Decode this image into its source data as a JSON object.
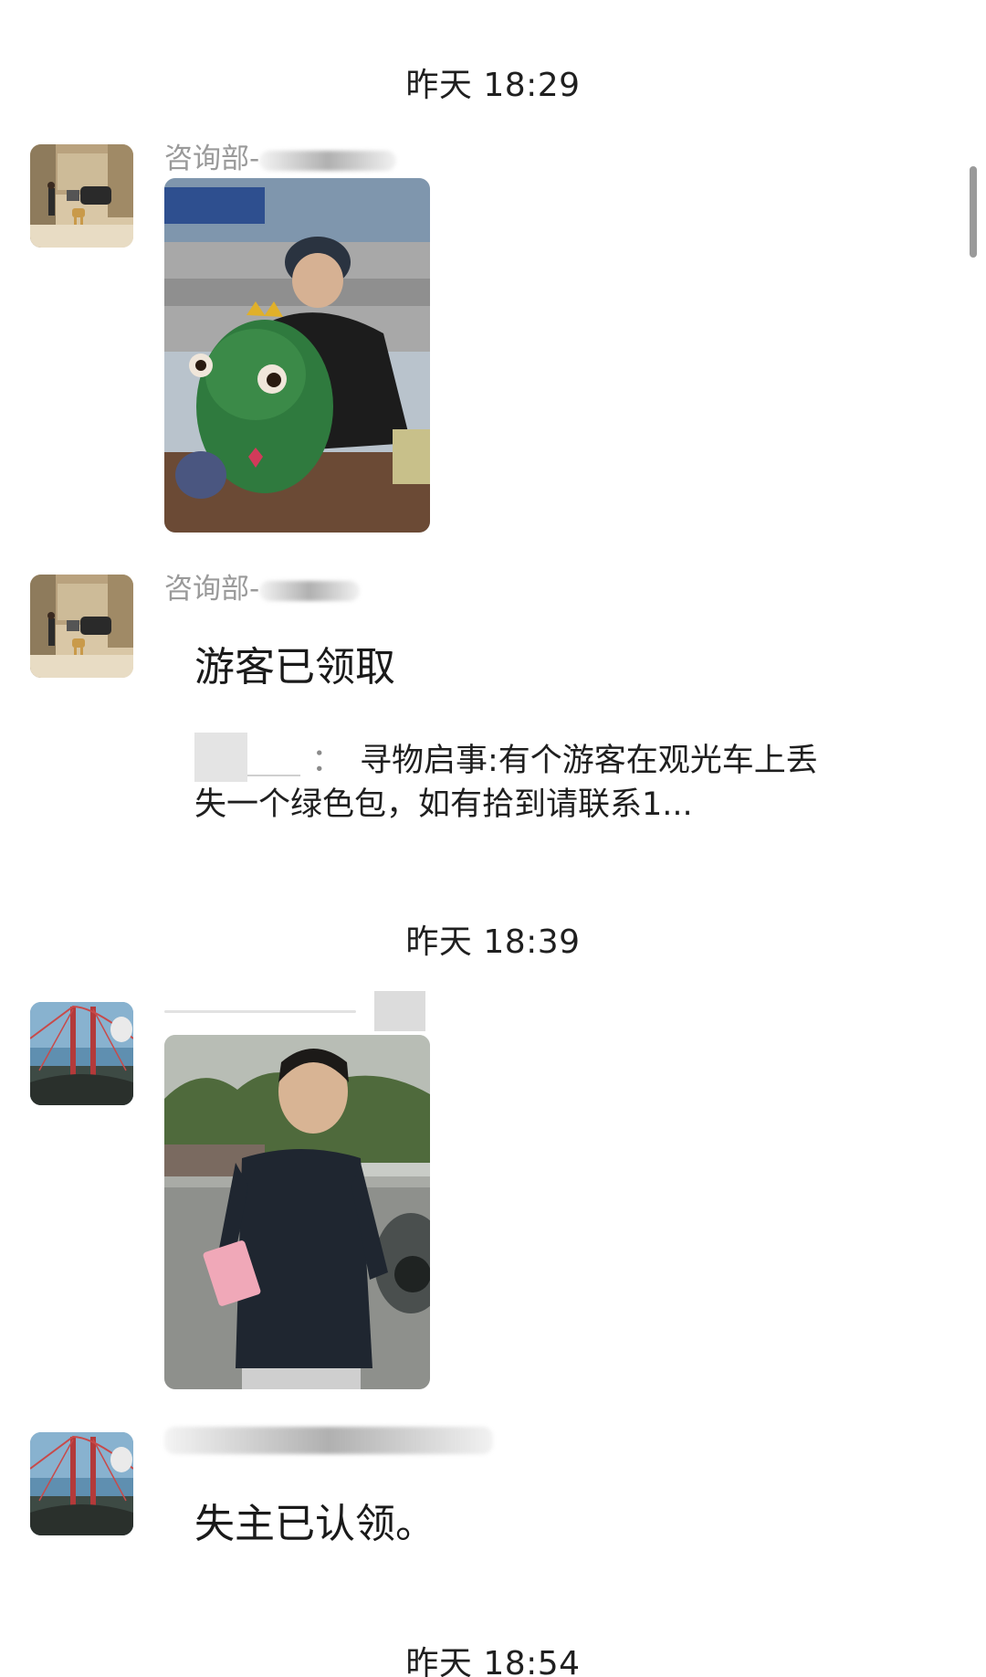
{
  "chat": {
    "timestamps": [
      "昨天 18:29",
      "昨天 18:39",
      "昨天 18:54"
    ],
    "messages": [
      {
        "sender": "咨询部-",
        "type": "image",
        "image_icon": "photo-man-with-frog-toy"
      },
      {
        "sender": "咨询部-",
        "type": "text",
        "text": "游客已领取"
      },
      {
        "sender": "",
        "type": "image",
        "image_icon": "photo-man-holding-pink-item"
      },
      {
        "sender": "",
        "type": "text",
        "text": "失主已认领。"
      }
    ],
    "notice": {
      "colon": "：",
      "text": "寻物启事:有个游客在观光车上丢失一个绿色包，如有拾到请联系1..."
    }
  },
  "colors": {
    "background": "#ffffff",
    "timestamp_text": "#1f1f1f",
    "sender_text": "#9a9a9a",
    "message_text": "#1a1a1a"
  }
}
